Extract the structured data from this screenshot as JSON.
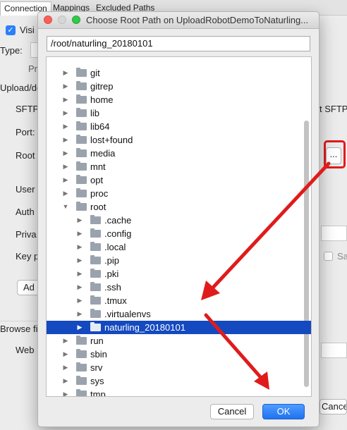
{
  "background": {
    "tabs": [
      "Connection",
      "Mappings",
      "Excluded Paths"
    ],
    "visible_label": "Visi",
    "type_label": "Type:",
    "pr_label": "Pr",
    "upload_label": "Upload/do",
    "labels": [
      "SFTP",
      "Port:",
      "Root",
      "User",
      "Auth",
      "Priva",
      "Key p"
    ],
    "right_sftp": "t SFTP",
    "add_button": "Ad",
    "browse_label": "Browse fil",
    "web_label": "Web",
    "browse_button": "...",
    "sa_label": "Sa",
    "cancel_button": "Cance"
  },
  "dialog": {
    "title": "Choose Root Path on UploadRobotDemoToNaturling...",
    "path_value": "/root/naturling_20180101",
    "tree": [
      {
        "label": "git",
        "level": 0,
        "expanded": false,
        "selected": false
      },
      {
        "label": "gitrep",
        "level": 0,
        "expanded": false,
        "selected": false
      },
      {
        "label": "home",
        "level": 0,
        "expanded": false,
        "selected": false
      },
      {
        "label": "lib",
        "level": 0,
        "expanded": false,
        "selected": false
      },
      {
        "label": "lib64",
        "level": 0,
        "expanded": false,
        "selected": false
      },
      {
        "label": "lost+found",
        "level": 0,
        "expanded": false,
        "selected": false
      },
      {
        "label": "media",
        "level": 0,
        "expanded": false,
        "selected": false
      },
      {
        "label": "mnt",
        "level": 0,
        "expanded": false,
        "selected": false
      },
      {
        "label": "opt",
        "level": 0,
        "expanded": false,
        "selected": false
      },
      {
        "label": "proc",
        "level": 0,
        "expanded": false,
        "selected": false
      },
      {
        "label": "root",
        "level": 0,
        "expanded": true,
        "selected": false
      },
      {
        "label": ".cache",
        "level": 1,
        "expanded": false,
        "selected": false
      },
      {
        "label": ".config",
        "level": 1,
        "expanded": false,
        "selected": false
      },
      {
        "label": ".local",
        "level": 1,
        "expanded": false,
        "selected": false
      },
      {
        "label": ".pip",
        "level": 1,
        "expanded": false,
        "selected": false
      },
      {
        "label": ".pki",
        "level": 1,
        "expanded": false,
        "selected": false
      },
      {
        "label": ".ssh",
        "level": 1,
        "expanded": false,
        "selected": false
      },
      {
        "label": ".tmux",
        "level": 1,
        "expanded": false,
        "selected": false
      },
      {
        "label": ".virtualenvs",
        "level": 1,
        "expanded": false,
        "selected": false
      },
      {
        "label": "naturling_20180101",
        "level": 1,
        "expanded": false,
        "selected": true
      },
      {
        "label": "run",
        "level": 0,
        "expanded": false,
        "selected": false
      },
      {
        "label": "sbin",
        "level": 0,
        "expanded": false,
        "selected": false
      },
      {
        "label": "srv",
        "level": 0,
        "expanded": false,
        "selected": false
      },
      {
        "label": "sys",
        "level": 0,
        "expanded": false,
        "selected": false
      },
      {
        "label": "tmp",
        "level": 0,
        "expanded": false,
        "selected": false
      }
    ],
    "cancel_label": "Cancel",
    "ok_label": "OK"
  },
  "colors": {
    "selection": "#1449bf",
    "accent": "#1f73f0",
    "annotation": "#e01b1b"
  },
  "icons": {
    "collapsed": "chevron-right-icon",
    "expanded": "chevron-down-icon",
    "folder": "folder-icon"
  }
}
